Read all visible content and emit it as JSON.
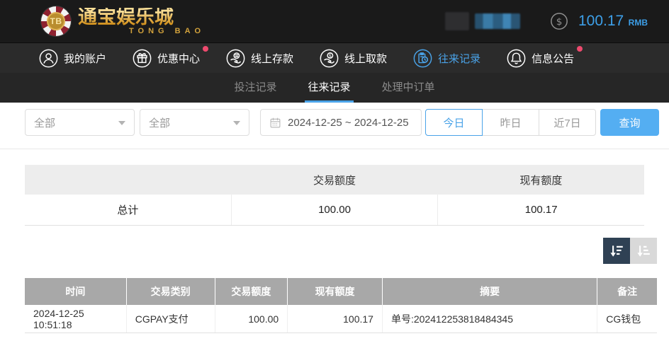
{
  "brand": {
    "chip_text": "TB",
    "title": "通宝娱乐城",
    "subtitle": "TONG BAO"
  },
  "account": {
    "balance": "100.17",
    "currency": "RMB"
  },
  "nav": {
    "items": [
      {
        "label": "我的账户",
        "icon": "user-icon",
        "active": false,
        "badge": false
      },
      {
        "label": "优惠中心",
        "icon": "gift-icon",
        "active": false,
        "badge": true
      },
      {
        "label": "线上存款",
        "icon": "deposit-icon",
        "active": false,
        "badge": false
      },
      {
        "label": "线上取款",
        "icon": "withdraw-icon",
        "active": false,
        "badge": false
      },
      {
        "label": "往来记录",
        "icon": "records-icon",
        "active": true,
        "badge": false
      },
      {
        "label": "信息公告",
        "icon": "bell-icon",
        "active": false,
        "badge": true
      }
    ]
  },
  "tabs": {
    "items": [
      {
        "label": "投注记录",
        "active": false
      },
      {
        "label": "往来记录",
        "active": true
      },
      {
        "label": "处理中订单",
        "active": false
      }
    ]
  },
  "filters": {
    "type_select": "全部",
    "category_select": "全部",
    "date_range": "2024-12-25 ~ 2024-12-25",
    "quick_ranges": [
      {
        "label": "今日",
        "active": true
      },
      {
        "label": "昨日",
        "active": false
      },
      {
        "label": "近7日",
        "active": false
      }
    ],
    "search_button": "查询"
  },
  "summary": {
    "columns": [
      "",
      "交易额度",
      "现有额度"
    ],
    "row_label": "总计",
    "transaction_amount": "100.00",
    "current_balance": "100.17"
  },
  "records": {
    "columns": [
      "时间",
      "交易类别",
      "交易额度",
      "现有额度",
      "摘要",
      "备注"
    ],
    "rows": [
      {
        "time": "2024-12-25 10:51:18",
        "type": "CGPAY支付",
        "amount": "100.00",
        "balance": "100.17",
        "summary": "单号:202412253818484345",
        "remark": "CG钱包"
      }
    ]
  },
  "colors": {
    "accent_blue": "#4aa3e8",
    "button_blue": "#54aef2",
    "badge_red": "#ee4a6e",
    "header_dark": "#1a1a1a",
    "nav_dark": "#2b2b2b",
    "tabbar_dark": "#262626",
    "table_header_gray": "#a8a8a8",
    "sort_active_navy": "#2f4154"
  }
}
